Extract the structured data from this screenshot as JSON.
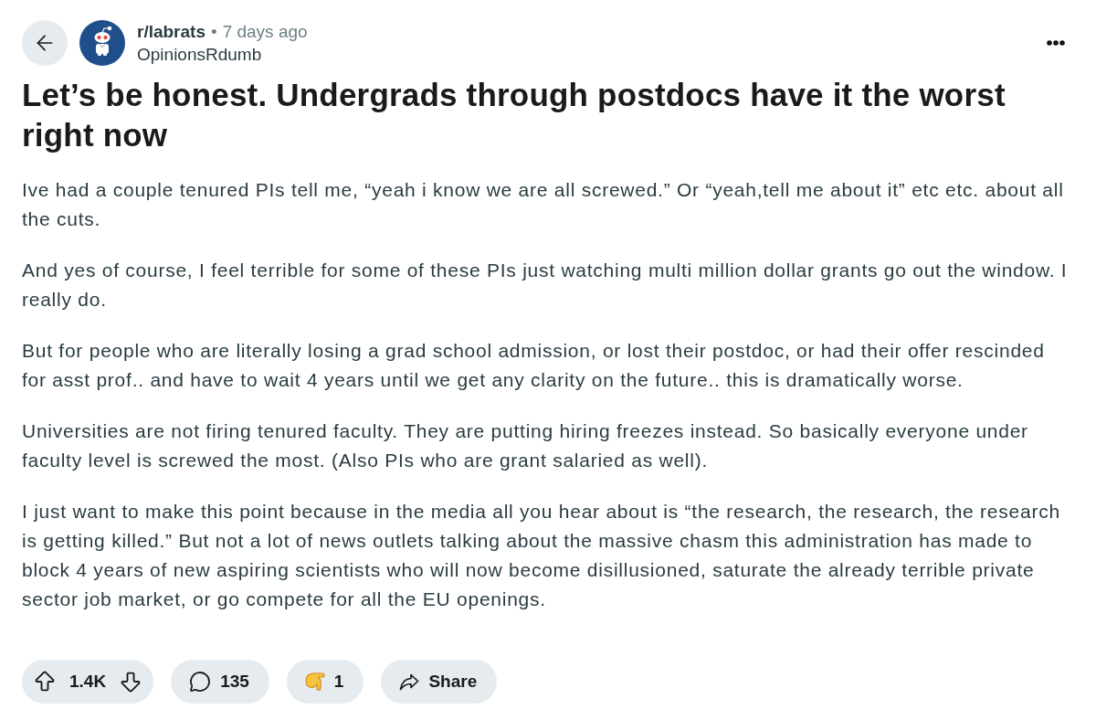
{
  "post": {
    "subreddit": "r/labrats",
    "separator": "•",
    "time": "7 days ago",
    "author": "OpinionsRdumb",
    "title": "Let’s be honest. Undergrads through postdocs have it the worst right now",
    "body": [
      "Ive had a couple tenured PIs tell me, “yeah i know we are all screwed.” Or “yeah,tell me about it” etc etc. about all the cuts.",
      "And yes of course, I feel terrible for some of these PIs just watching multi million dollar grants go out the window. I really do.",
      "But for people who are literally losing a grad school admission, or lost their postdoc, or had their offer rescinded for asst prof.. and have to wait 4 years until we get any clarity on the future.. this is dramatically worse.",
      "Universities are not firing tenured faculty. They are putting hiring freezes instead. So basically everyone under faculty level is screwed the most. (Also PIs who are grant salaried as well).",
      "I just want to make this point because in the media all you hear about is “the research, the research, the research is getting killed.” But not a lot of news outlets talking about the massive chasm this administration has made to block 4 years of new aspiring scientists who will now become disillusioned, saturate the already terrible private sector job market, or go compete for all the EU openings."
    ]
  },
  "actions": [
    {
      "kind": "vote",
      "count": "1.4K"
    },
    {
      "kind": "comments",
      "count": "135"
    },
    {
      "kind": "award",
      "count": "1"
    },
    {
      "kind": "share",
      "label": "Share"
    }
  ]
}
